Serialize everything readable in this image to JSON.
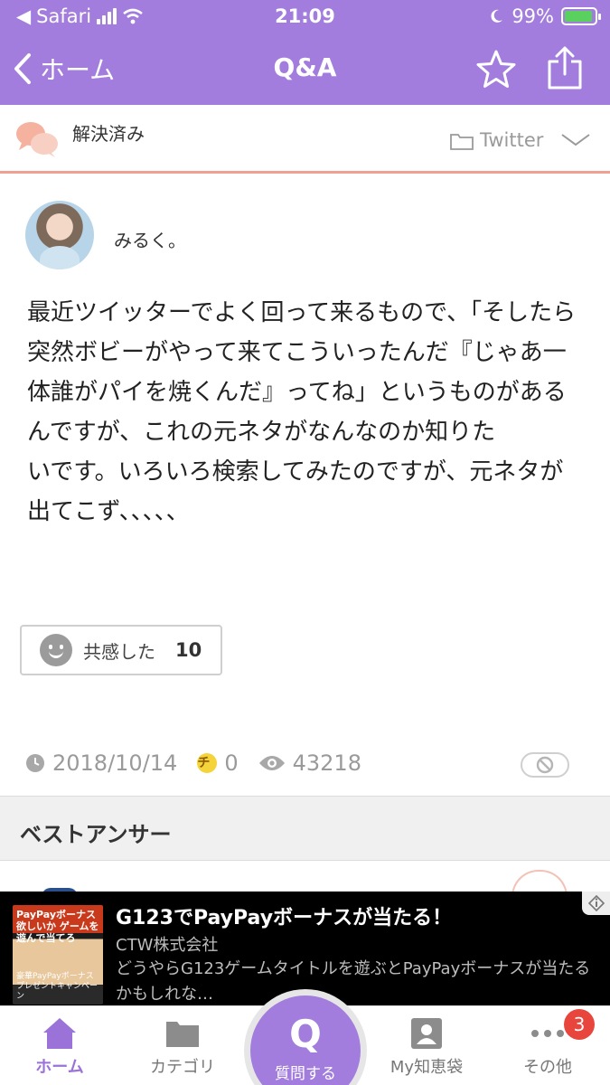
{
  "status_bar": {
    "carrier": "Safari",
    "time": "21:09",
    "battery": "99%"
  },
  "nav": {
    "back_label": "ホーム",
    "title": "Q&A"
  },
  "question_meta": {
    "status": "解決済み",
    "category": "Twitter"
  },
  "question": {
    "username": "みるく。",
    "body": "最近ツイッターでよく回って来るもので、「そしたら突然ボビーがやって来てこういったんだ『じゃあ一体誰がパイを焼くんだ』ってね」というものがあるんですが、これの元ネタがなんなのか知りた\nいです。いろいろ検索してみたのですが、元ネタが出てこず、、、、、",
    "empathy_label": "共感した",
    "empathy_count": "10",
    "date": "2018/10/14",
    "chie_coin": "0",
    "views": "43218"
  },
  "best_answer": {
    "heading": "ベストアンサー"
  },
  "ad": {
    "title": "G123でPayPayボーナスが当たる！",
    "company": "CTW株式会社",
    "description": "どうやらG123ゲームタイトルを遊ぶとPayPayボーナスが当たるかもしれな…",
    "image_text_top": "PayPayボーナス欲しいか ゲームを遊んで当てろ",
    "image_text_bottom": "豪華PayPayボーナス プレゼントキャンペーン"
  },
  "tabbar": {
    "home": "ホーム",
    "category": "カテゴリ",
    "ask_symbol": "Q",
    "ask": "質問する",
    "my": "My知恵袋",
    "more": "その他",
    "more_badge": "3"
  },
  "colors": {
    "brand_purple": "#a27ddd",
    "accent_salmon": "#f0a191",
    "badge_red": "#e8453c"
  }
}
